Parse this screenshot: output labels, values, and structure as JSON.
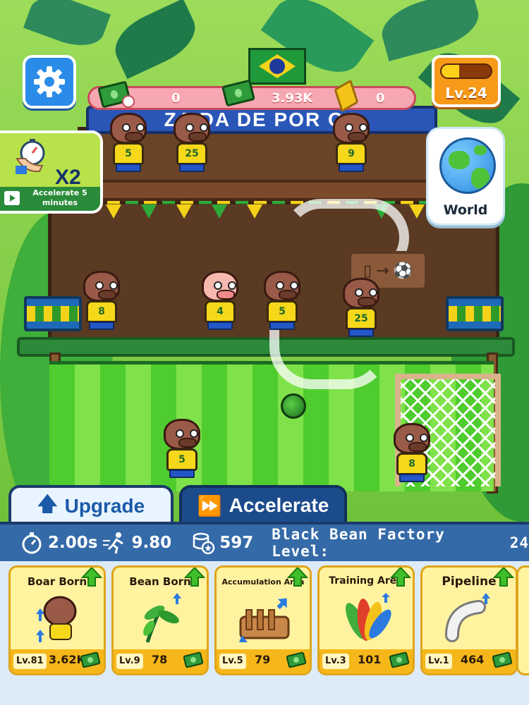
{
  "hud": {
    "resources": [
      {
        "name": "cash-per-time",
        "value": "0"
      },
      {
        "name": "cash",
        "value": "3.93K"
      },
      {
        "name": "gold",
        "value": "0"
      }
    ],
    "level": "Lv.24",
    "level_progress": 0.35,
    "world_label": "World",
    "accelerate_card": {
      "multiplier": "X2",
      "caption": "Accelerate 5 minutes"
    }
  },
  "scene": {
    "banner_text": "ZA DA DE POR OS",
    "players": [
      {
        "number": "5",
        "species": "boar"
      },
      {
        "number": "25",
        "species": "boar"
      },
      {
        "number": "9",
        "species": "boar"
      },
      {
        "number": "8",
        "species": "boar"
      },
      {
        "number": "4",
        "species": "pig"
      },
      {
        "number": "5",
        "species": "boar"
      },
      {
        "number": "25",
        "species": "boar"
      },
      {
        "number": "5",
        "species": "boar"
      },
      {
        "number": "8",
        "species": "boar"
      }
    ]
  },
  "tabs": {
    "upgrade": "Upgrade",
    "accelerate": "Accelerate"
  },
  "stats": {
    "time": "2.00s",
    "speed": "9.80",
    "coins": "597",
    "factory_label": "Black Bean Factory Level:",
    "factory_level": "24"
  },
  "cards": [
    {
      "title": "Boar Born",
      "level": "Lv.81",
      "cost": "3.62K"
    },
    {
      "title": "Bean Born",
      "level": "Lv.9",
      "cost": "78"
    },
    {
      "title": "Accumulation Area",
      "level": "Lv.5",
      "cost": "79"
    },
    {
      "title": "Training Area",
      "level": "Lv.3",
      "cost": "101"
    },
    {
      "title": "Pipeline",
      "level": "Lv.1",
      "cost": "464"
    }
  ],
  "colors": {
    "accent": "#1a5aa8",
    "upgrade_arrow": "#3fbf2a",
    "card_bg": "#fff3a0",
    "stats_bar": "#356aa8"
  }
}
